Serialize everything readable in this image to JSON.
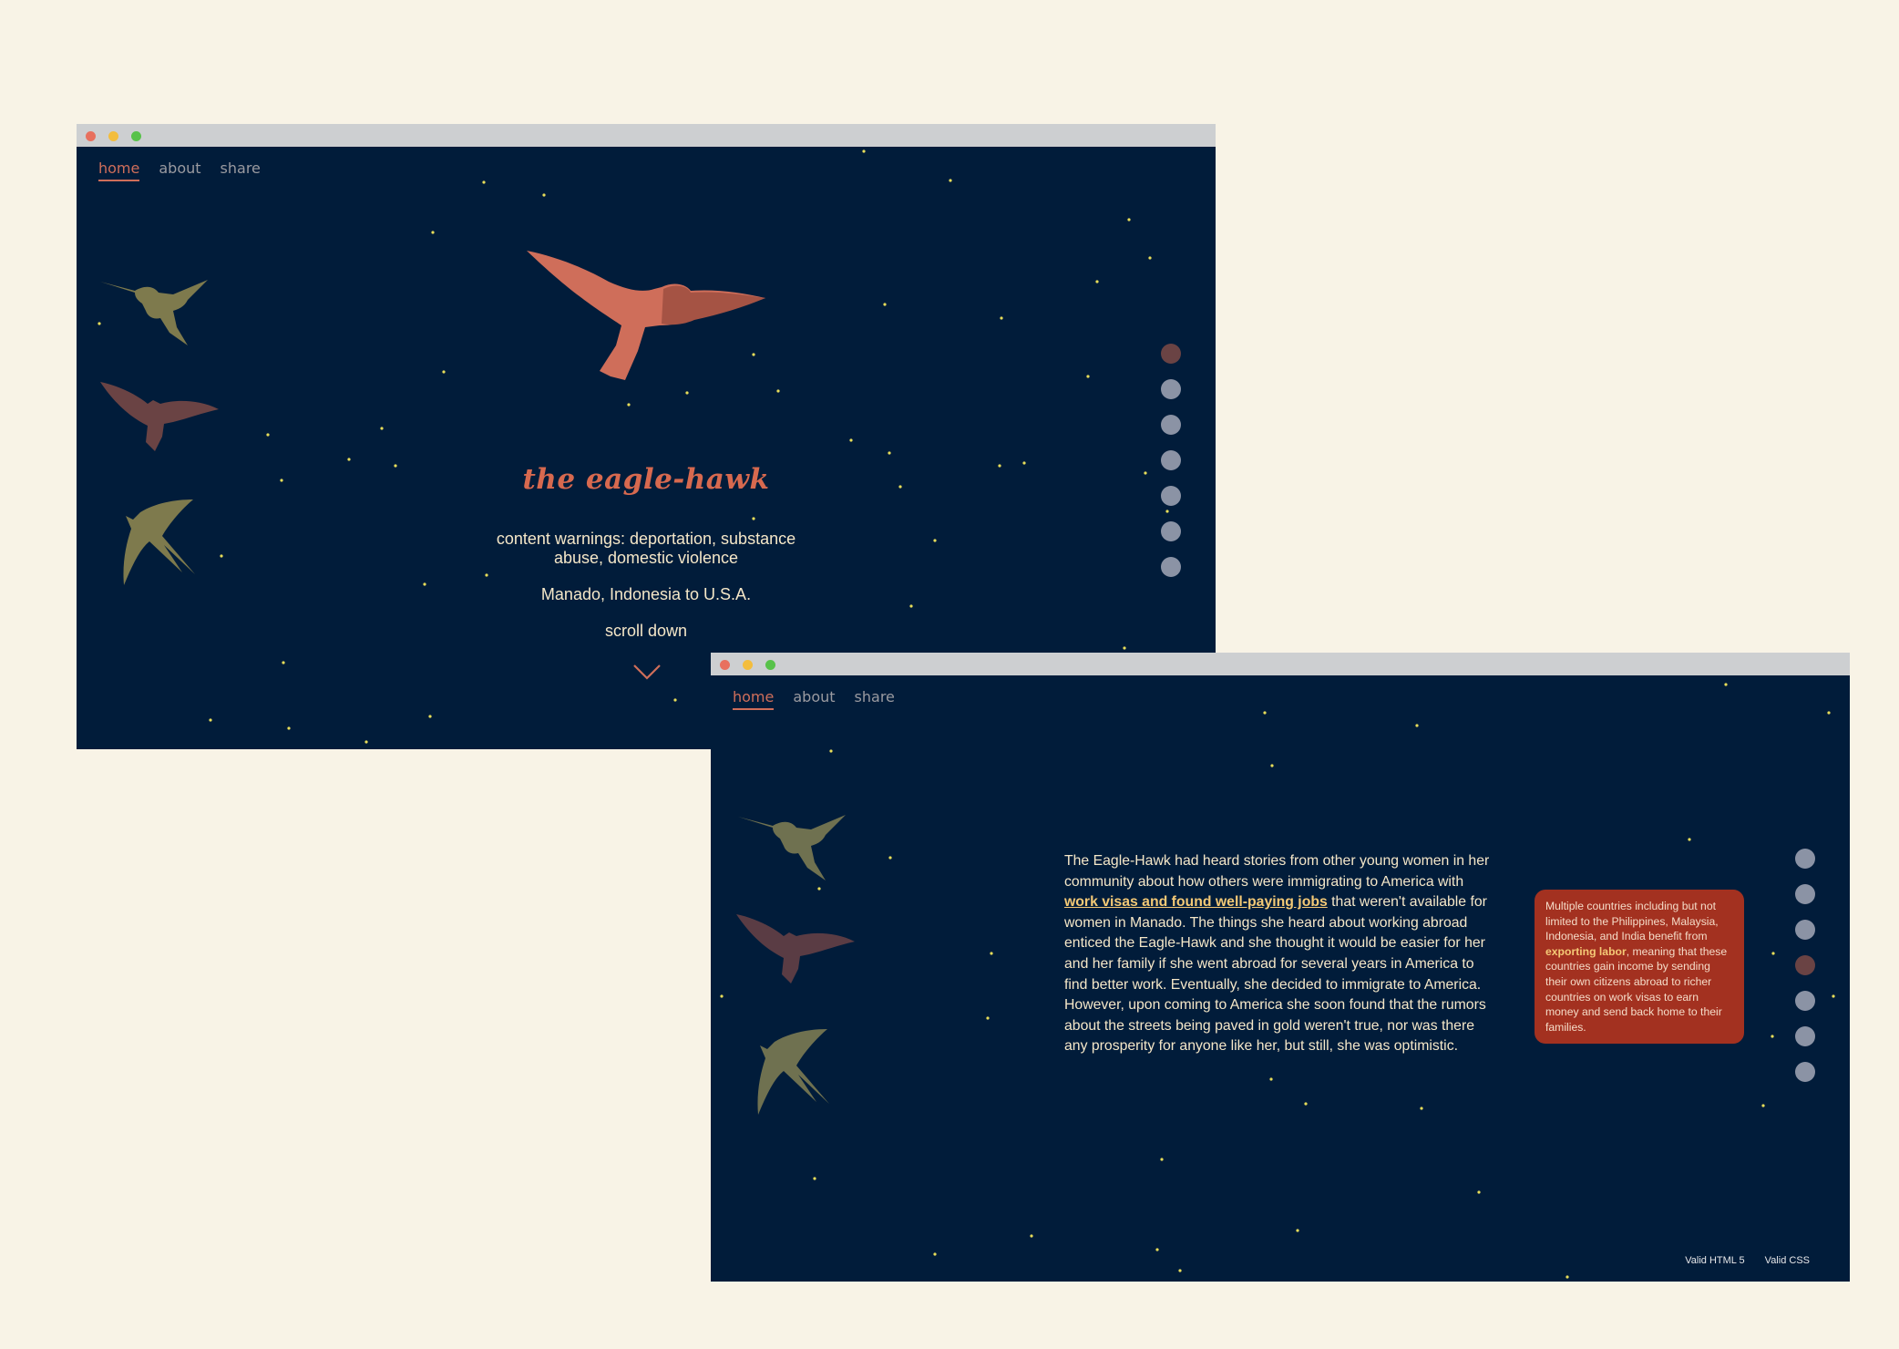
{
  "window1": {
    "nav": [
      "home",
      "about",
      "share"
    ],
    "title": "the eagle-hawk",
    "content_warning": "content warnings: deportation, substance abuse, domestic violence",
    "route": "Manado, Indonesia to U.S.A.",
    "scroll_prompt": "scroll down",
    "current_dot": 1
  },
  "window2": {
    "nav": [
      "home",
      "about",
      "share"
    ],
    "story": {
      "part1": "The Eagle-Hawk had heard stories from other young women in her community about how others were immigrating to America with ",
      "link": "work visas and found well-paying jobs",
      "part2": " that weren't available for women in Manado. The things she heard about working abroad enticed the Eagle-Hawk and she thought it would be easier for her and her family if she went abroad for several years in America to find better work. Eventually, she decided to immigrate to America. However, upon coming to America she soon found that the rumors about the streets being paved in gold weren't true, nor was there any prosperity for anyone like her, but still, she was optimistic."
    },
    "infobox": {
      "part1": "Multiple countries including but not limited to the Philippines, Malaysia, Indonesia, and India benefit from ",
      "link": "exporting labor",
      "part2": ", meaning that these countries gain income by sending their own citizens abroad to richer countries on work visas to earn money and send back home to their families."
    },
    "footer": [
      "Valid HTML 5",
      "Valid CSS"
    ],
    "current_dot": 4
  },
  "colors": {
    "page_bg": "#f8f3e6",
    "window_bg": "#011c3a",
    "accent": "#cf6e5a",
    "text": "#f5e7c8",
    "link": "#f4c976",
    "infobox_bg": "#a33120",
    "star": "#e8dd5a"
  },
  "icons": [
    "hummingbird-icon",
    "eagle-icon",
    "swallow-icon",
    "chevron-down-icon"
  ]
}
